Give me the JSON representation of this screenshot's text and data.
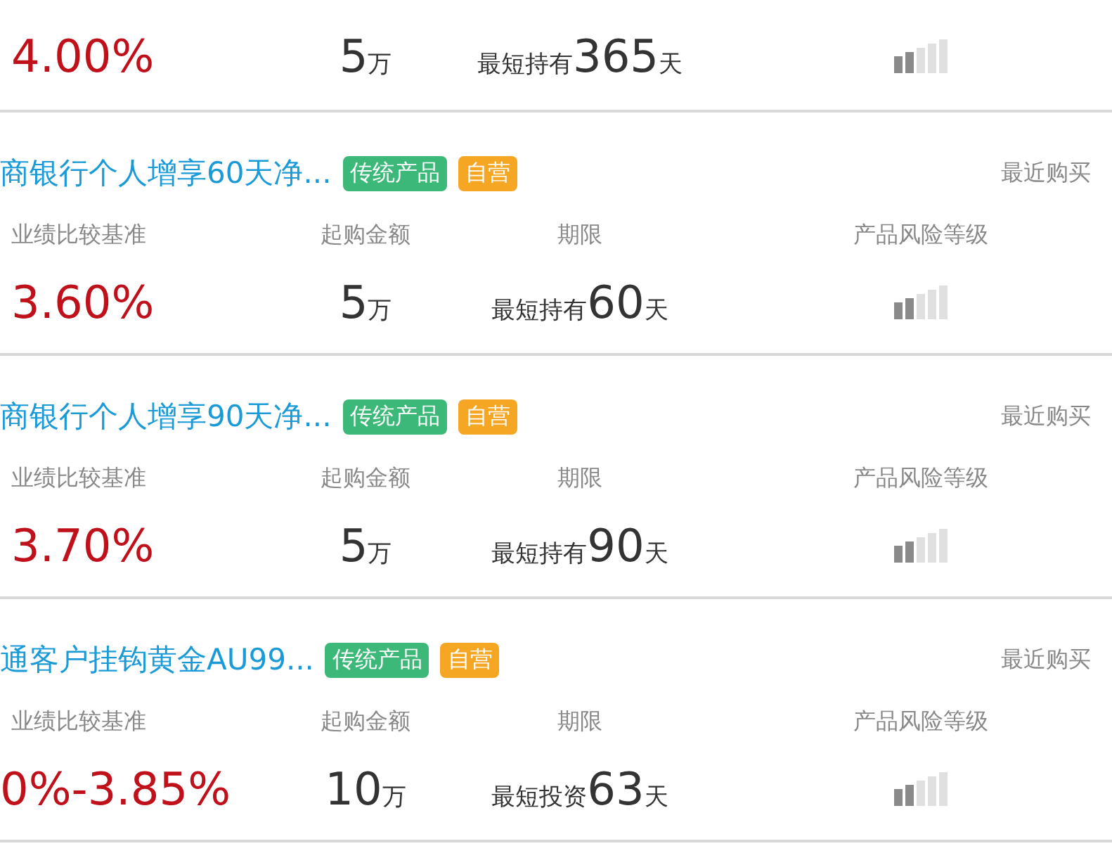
{
  "products": [
    {
      "rate": "4.00%",
      "amount": "5",
      "amount_unit": "万",
      "term_prefix": "最短持有",
      "term": "365",
      "term_unit": "天",
      "risk": {
        "level": 0.4
      }
    },
    {
      "title": "商银行个人增享60天净...",
      "tags": [
        {
          "label": "传统产品",
          "kind": "type"
        },
        {
          "label": "自营",
          "kind": "channel"
        }
      ],
      "recent": "最近购买",
      "labels": [
        "业绩比较基准",
        "起购金额",
        "期限",
        "产品风险等级"
      ],
      "rate": "3.60%",
      "amount": "5",
      "amount_unit": "万",
      "term_prefix": "最短持有",
      "term": "60",
      "term_unit": "天",
      "risk": {
        "level": 0.4
      }
    },
    {
      "title": "商银行个人增享90天净...",
      "tags": [
        {
          "label": "传统产品",
          "kind": "type"
        },
        {
          "label": "自营",
          "kind": "channel"
        }
      ],
      "recent": "最近购买",
      "labels": [
        "业绩比较基准",
        "起购金额",
        "期限",
        "产品风险等级"
      ],
      "rate": "3.70%",
      "amount": "5",
      "amount_unit": "万",
      "term_prefix": "最短持有",
      "term": "90",
      "term_unit": "天",
      "risk": {
        "level": 0.4
      }
    },
    {
      "title": "通客户挂钩黄金AU99...",
      "tags": [
        {
          "label": "传统产品",
          "kind": "type"
        },
        {
          "label": "自营",
          "kind": "channel"
        }
      ],
      "recent": "最近购买",
      "labels": [
        "业绩比较基准",
        "起购金额",
        "期限",
        "产品风险等级"
      ],
      "rate": "0%-3.85%",
      "amount": "10",
      "amount_unit": "万",
      "term_prefix": "最短投资",
      "term": "63",
      "term_unit": "天",
      "risk": {
        "level": 0.4
      }
    }
  ]
}
